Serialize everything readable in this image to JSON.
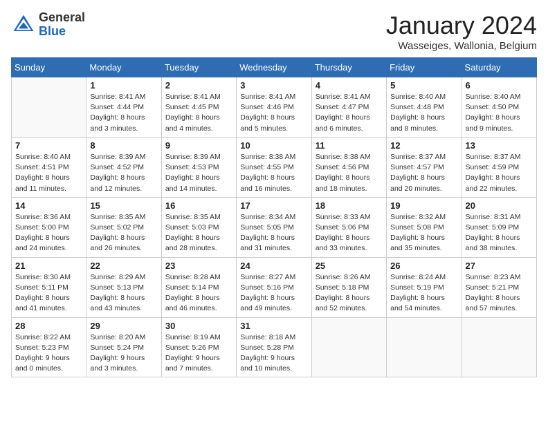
{
  "header": {
    "logo_general": "General",
    "logo_blue": "Blue",
    "month_title": "January 2024",
    "subtitle": "Wasseiges, Wallonia, Belgium"
  },
  "calendar": {
    "days_of_week": [
      "Sunday",
      "Monday",
      "Tuesday",
      "Wednesday",
      "Thursday",
      "Friday",
      "Saturday"
    ],
    "weeks": [
      [
        {
          "day": "",
          "info": ""
        },
        {
          "day": "1",
          "info": "Sunrise: 8:41 AM\nSunset: 4:44 PM\nDaylight: 8 hours\nand 3 minutes."
        },
        {
          "day": "2",
          "info": "Sunrise: 8:41 AM\nSunset: 4:45 PM\nDaylight: 8 hours\nand 4 minutes."
        },
        {
          "day": "3",
          "info": "Sunrise: 8:41 AM\nSunset: 4:46 PM\nDaylight: 8 hours\nand 5 minutes."
        },
        {
          "day": "4",
          "info": "Sunrise: 8:41 AM\nSunset: 4:47 PM\nDaylight: 8 hours\nand 6 minutes."
        },
        {
          "day": "5",
          "info": "Sunrise: 8:40 AM\nSunset: 4:48 PM\nDaylight: 8 hours\nand 8 minutes."
        },
        {
          "day": "6",
          "info": "Sunrise: 8:40 AM\nSunset: 4:50 PM\nDaylight: 8 hours\nand 9 minutes."
        }
      ],
      [
        {
          "day": "7",
          "info": "Sunrise: 8:40 AM\nSunset: 4:51 PM\nDaylight: 8 hours\nand 11 minutes."
        },
        {
          "day": "8",
          "info": "Sunrise: 8:39 AM\nSunset: 4:52 PM\nDaylight: 8 hours\nand 12 minutes."
        },
        {
          "day": "9",
          "info": "Sunrise: 8:39 AM\nSunset: 4:53 PM\nDaylight: 8 hours\nand 14 minutes."
        },
        {
          "day": "10",
          "info": "Sunrise: 8:38 AM\nSunset: 4:55 PM\nDaylight: 8 hours\nand 16 minutes."
        },
        {
          "day": "11",
          "info": "Sunrise: 8:38 AM\nSunset: 4:56 PM\nDaylight: 8 hours\nand 18 minutes."
        },
        {
          "day": "12",
          "info": "Sunrise: 8:37 AM\nSunset: 4:57 PM\nDaylight: 8 hours\nand 20 minutes."
        },
        {
          "day": "13",
          "info": "Sunrise: 8:37 AM\nSunset: 4:59 PM\nDaylight: 8 hours\nand 22 minutes."
        }
      ],
      [
        {
          "day": "14",
          "info": "Sunrise: 8:36 AM\nSunset: 5:00 PM\nDaylight: 8 hours\nand 24 minutes."
        },
        {
          "day": "15",
          "info": "Sunrise: 8:35 AM\nSunset: 5:02 PM\nDaylight: 8 hours\nand 26 minutes."
        },
        {
          "day": "16",
          "info": "Sunrise: 8:35 AM\nSunset: 5:03 PM\nDaylight: 8 hours\nand 28 minutes."
        },
        {
          "day": "17",
          "info": "Sunrise: 8:34 AM\nSunset: 5:05 PM\nDaylight: 8 hours\nand 31 minutes."
        },
        {
          "day": "18",
          "info": "Sunrise: 8:33 AM\nSunset: 5:06 PM\nDaylight: 8 hours\nand 33 minutes."
        },
        {
          "day": "19",
          "info": "Sunrise: 8:32 AM\nSunset: 5:08 PM\nDaylight: 8 hours\nand 35 minutes."
        },
        {
          "day": "20",
          "info": "Sunrise: 8:31 AM\nSunset: 5:09 PM\nDaylight: 8 hours\nand 38 minutes."
        }
      ],
      [
        {
          "day": "21",
          "info": "Sunrise: 8:30 AM\nSunset: 5:11 PM\nDaylight: 8 hours\nand 41 minutes."
        },
        {
          "day": "22",
          "info": "Sunrise: 8:29 AM\nSunset: 5:13 PM\nDaylight: 8 hours\nand 43 minutes."
        },
        {
          "day": "23",
          "info": "Sunrise: 8:28 AM\nSunset: 5:14 PM\nDaylight: 8 hours\nand 46 minutes."
        },
        {
          "day": "24",
          "info": "Sunrise: 8:27 AM\nSunset: 5:16 PM\nDaylight: 8 hours\nand 49 minutes."
        },
        {
          "day": "25",
          "info": "Sunrise: 8:26 AM\nSunset: 5:18 PM\nDaylight: 8 hours\nand 52 minutes."
        },
        {
          "day": "26",
          "info": "Sunrise: 8:24 AM\nSunset: 5:19 PM\nDaylight: 8 hours\nand 54 minutes."
        },
        {
          "day": "27",
          "info": "Sunrise: 8:23 AM\nSunset: 5:21 PM\nDaylight: 8 hours\nand 57 minutes."
        }
      ],
      [
        {
          "day": "28",
          "info": "Sunrise: 8:22 AM\nSunset: 5:23 PM\nDaylight: 9 hours\nand 0 minutes."
        },
        {
          "day": "29",
          "info": "Sunrise: 8:20 AM\nSunset: 5:24 PM\nDaylight: 9 hours\nand 3 minutes."
        },
        {
          "day": "30",
          "info": "Sunrise: 8:19 AM\nSunset: 5:26 PM\nDaylight: 9 hours\nand 7 minutes."
        },
        {
          "day": "31",
          "info": "Sunrise: 8:18 AM\nSunset: 5:28 PM\nDaylight: 9 hours\nand 10 minutes."
        },
        {
          "day": "",
          "info": ""
        },
        {
          "day": "",
          "info": ""
        },
        {
          "day": "",
          "info": ""
        }
      ]
    ]
  }
}
